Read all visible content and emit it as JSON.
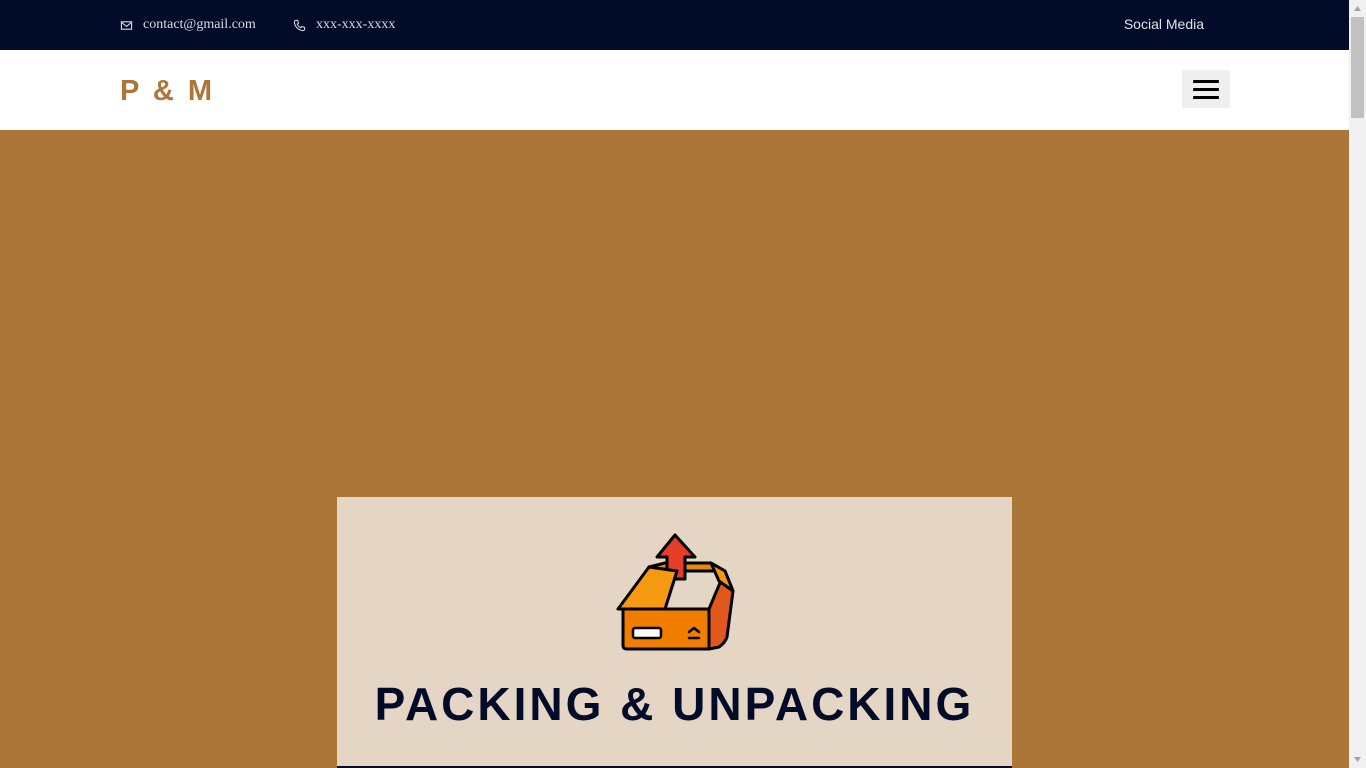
{
  "topbar": {
    "email": "contact@gmail.com",
    "phone": "xxx-xxx-xxxx",
    "social": "Social Media",
    "email_icon": "envelope-icon",
    "phone_icon": "phone-icon"
  },
  "navbar": {
    "logo": "P & M",
    "menu_icon": "hamburger-menu-icon"
  },
  "service_card": {
    "icon": "open-box-upload-icon",
    "title": "PACKING & UNPACKING"
  },
  "colors": {
    "topbar_bg": "#020b27",
    "brand": "#ab7637",
    "card_bg": "#e5d5c5",
    "heading": "#020b27"
  }
}
